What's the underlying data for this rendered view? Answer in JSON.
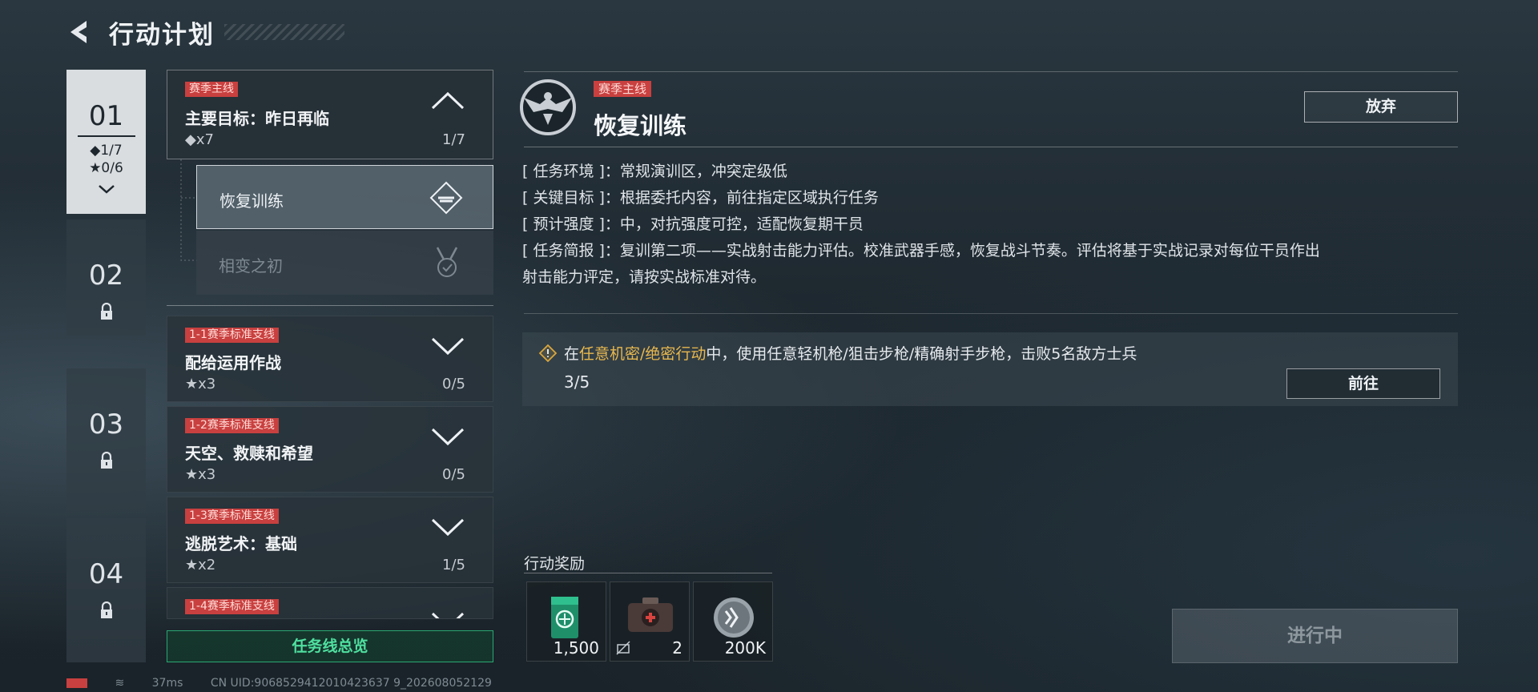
{
  "header": {
    "title": "行动计划"
  },
  "chapters": [
    {
      "num": "01",
      "diamond": "◆1/7",
      "star": "★0/6",
      "active": true
    },
    {
      "num": "02",
      "locked": true
    },
    {
      "num": "03",
      "locked": true
    },
    {
      "num": "04",
      "locked": true
    }
  ],
  "main_quest": {
    "tag": "赛季主线",
    "name": "主要目标：昨日再临",
    "reward": "◆x7",
    "progress": "1/7"
  },
  "sub_quests": [
    {
      "label": "恢复训练",
      "active": true
    },
    {
      "label": "相变之初",
      "active": false
    }
  ],
  "branch_quests": [
    {
      "tag": "1-1赛季标准支线",
      "name": "配给运用作战",
      "reward": "★x3",
      "progress": "0/5"
    },
    {
      "tag": "1-2赛季标准支线",
      "name": "天空、救赎和希望",
      "reward": "★x3",
      "progress": "0/5"
    },
    {
      "tag": "1-3赛季标准支线",
      "name": "逃脱艺术：基础",
      "reward": "★x2",
      "progress": "1/5"
    },
    {
      "tag": "1-4赛季标准支线"
    }
  ],
  "overview_label": "任务线总览",
  "detail": {
    "tag": "赛季主线",
    "title": "恢复训练",
    "abandon_label": "放弃",
    "info": [
      "[ 任务环境 ]：常规演训区，冲突定级低",
      "[ 关键目标 ]：根据委托内容，前往指定区域执行任务",
      "[ 预计强度 ]：中，对抗强度可控，适配恢复期干员",
      "[ 任务简报 ]：复训第二项——实战射击能力评估。校准武器手感，恢复战斗节奏。评估将基于实战记录对每位干员作出",
      "射击能力评定，请按实战标准对待。"
    ],
    "objective": {
      "prefix": "在",
      "highlight": "任意机密/绝密行动",
      "suffix": "中，使用任意轻机枪/狙击步枪/精确射手步枪，击败5名敌方士兵",
      "progress": "3/5",
      "goto_label": "前往"
    },
    "rewards_label": "行动奖励",
    "rewards": [
      {
        "icon": "green-crate-icon",
        "amount": "1,500"
      },
      {
        "icon": "medkit-icon",
        "amount": "2"
      },
      {
        "icon": "silver-coin-icon",
        "amount": "200K"
      }
    ],
    "status_label": "进行中"
  },
  "footer": {
    "ping": "37ms",
    "uid": "CN UID:9068529412010423637 9_202608052129"
  },
  "colors": {
    "accent_green": "#4fe0a0",
    "tag_red": "#c8403f",
    "highlight_gold": "#e8b84e"
  }
}
